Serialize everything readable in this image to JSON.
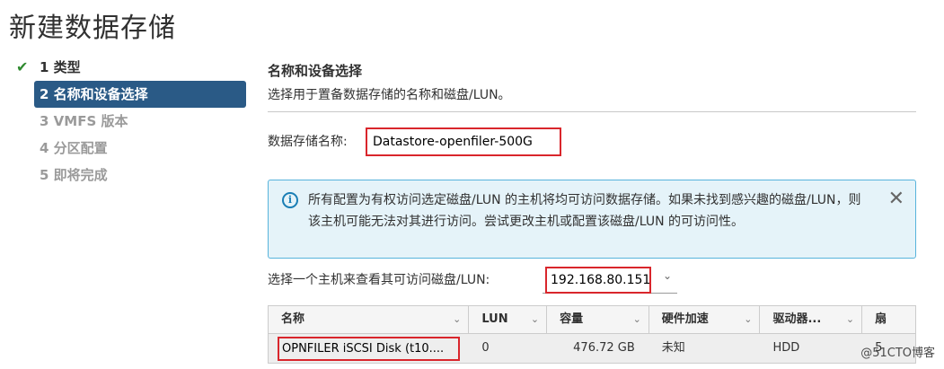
{
  "page": {
    "title": "新建数据存储"
  },
  "wizard": {
    "steps": [
      {
        "label": "1 类型",
        "state": "done"
      },
      {
        "label": "2 名称和设备选择",
        "state": "active"
      },
      {
        "label": "3 VMFS 版本",
        "state": "pending"
      },
      {
        "label": "4 分区配置",
        "state": "pending"
      },
      {
        "label": "5 即将完成",
        "state": "pending"
      }
    ],
    "check_icon": "check-icon"
  },
  "section": {
    "title": "名称和设备选择",
    "subtitle": "选择用于置备数据存储的名称和磁盘/LUN。"
  },
  "datastore_name": {
    "label": "数据存储名称:",
    "value": "Datastore-openfiler-500G"
  },
  "info_alert": {
    "icon": "info-icon",
    "text": "所有配置为有权访问选定磁盘/LUN 的主机将均可访问数据存储。如果未找到感兴趣的磁盘/LUN，则该主机可能无法对其进行访问。尝试更改主机或配置该磁盘/LUN 的可访问性。",
    "close_icon": "close-icon"
  },
  "host_select": {
    "label": "选择一个主机来查看其可访问磁盘/LUN:",
    "value": "192.168.80.151"
  },
  "disk_table": {
    "columns": [
      "名称",
      "LUN",
      "容量",
      "硬件加速",
      "驱动器...",
      "扇"
    ],
    "rows": [
      [
        "OPNFILER iSCSI Disk (t10....",
        "0",
        "476.72 GB",
        "未知",
        "HDD",
        "5"
      ]
    ]
  },
  "watermark": "@51CTO博客",
  "colors": {
    "active_step_bg": "#2a5a86",
    "highlight_border": "#d9262c",
    "alert_bg": "#e5f3f9",
    "alert_border": "#57b3dc",
    "check": "#2f8a2f"
  }
}
